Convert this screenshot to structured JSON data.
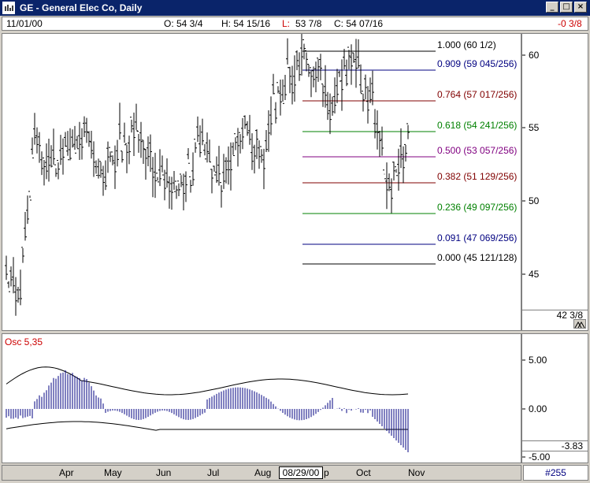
{
  "window": {
    "title": "GE - General Elec Co, Daily",
    "btn_min": "_",
    "btn_max": "□",
    "btn_close": "×"
  },
  "quote": {
    "date": "11/01/00",
    "open": "O: 54 3/4",
    "high": "H: 54 15/16",
    "low_label": "L:",
    "low": "53 7/8",
    "close": "C: 54 07/16",
    "change": "-0 3/8"
  },
  "price_panel": {
    "yaxis": [
      "60",
      "55",
      "50",
      "45"
    ],
    "last_price": "42 3/8",
    "fib_levels": [
      {
        "ratio": "1.000",
        "price": "(60 1/2)",
        "color": "#000000"
      },
      {
        "ratio": "0.909",
        "price": "(59 045/256)",
        "color": "#000080"
      },
      {
        "ratio": "0.764",
        "price": "(57 017/256)",
        "color": "#800000"
      },
      {
        "ratio": "0.618",
        "price": "(54 241/256)",
        "color": "#008000"
      },
      {
        "ratio": "0.500",
        "price": "(53 057/256)",
        "color": "#800080"
      },
      {
        "ratio": "0.382",
        "price": "(51 129/256)",
        "color": "#800000"
      },
      {
        "ratio": "0.236",
        "price": "(49 097/256)",
        "color": "#008000"
      },
      {
        "ratio": "0.091",
        "price": "(47 069/256)",
        "color": "#000080"
      },
      {
        "ratio": "0.000",
        "price": "(45 121/128)",
        "color": "#000000"
      }
    ]
  },
  "osc_panel": {
    "label": "Osc 5,35",
    "yaxis": [
      "5.00",
      "0.00",
      "-5.00"
    ],
    "last_value": "-3.83"
  },
  "dates": {
    "months": [
      "Apr",
      "May",
      "Jun",
      "Jul",
      "Aug",
      "p",
      "Oct",
      "Nov"
    ],
    "cursor": "08/29/00"
  },
  "counter": "#255",
  "colors": {
    "title_bg": "#0a246a",
    "price_bars": "#000000",
    "osc_bars": "#000080",
    "osc_label": "#cc0000"
  }
}
